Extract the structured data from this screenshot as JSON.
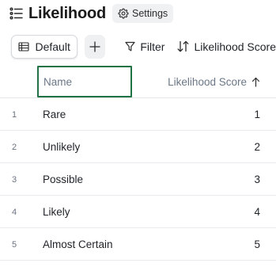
{
  "header": {
    "title": "Likelihood",
    "title_icon": "list-icon",
    "settings_label": "Settings",
    "settings_icon": "gear-icon"
  },
  "toolbar": {
    "view_label": "Default",
    "view_icon": "table-icon",
    "add_icon": "plus-icon",
    "filter_label": "Filter",
    "sort_label": "Likelihood Score"
  },
  "table": {
    "columns": [
      "Name",
      "Likelihood Score"
    ],
    "sort_direction": "ascending",
    "rows": [
      {
        "num": "1",
        "name": "Rare",
        "score": "1"
      },
      {
        "num": "2",
        "name": "Unlikely",
        "score": "2"
      },
      {
        "num": "3",
        "name": "Possible",
        "score": "3"
      },
      {
        "num": "4",
        "name": "Likely",
        "score": "4"
      },
      {
        "num": "5",
        "name": "Almost Certain",
        "score": "5"
      }
    ]
  },
  "colors": {
    "selected_header_border": "#217346",
    "header_text": "#6b7787"
  }
}
